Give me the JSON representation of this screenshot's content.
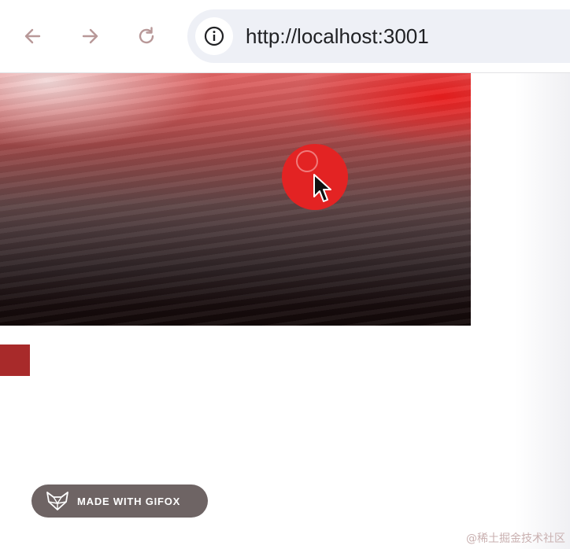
{
  "browser": {
    "url": "http://localhost:3001"
  },
  "badge": {
    "label": "MADE WITH GIFOX"
  },
  "watermark": {
    "text": "@稀土掘金技术社区"
  },
  "colors": {
    "accent": "#e32323",
    "swatch": "#a82a2a"
  },
  "icons": [
    "back-arrow-icon",
    "forward-arrow-icon",
    "reload-icon",
    "info-icon",
    "cursor-icon",
    "fox-logo-icon"
  ]
}
